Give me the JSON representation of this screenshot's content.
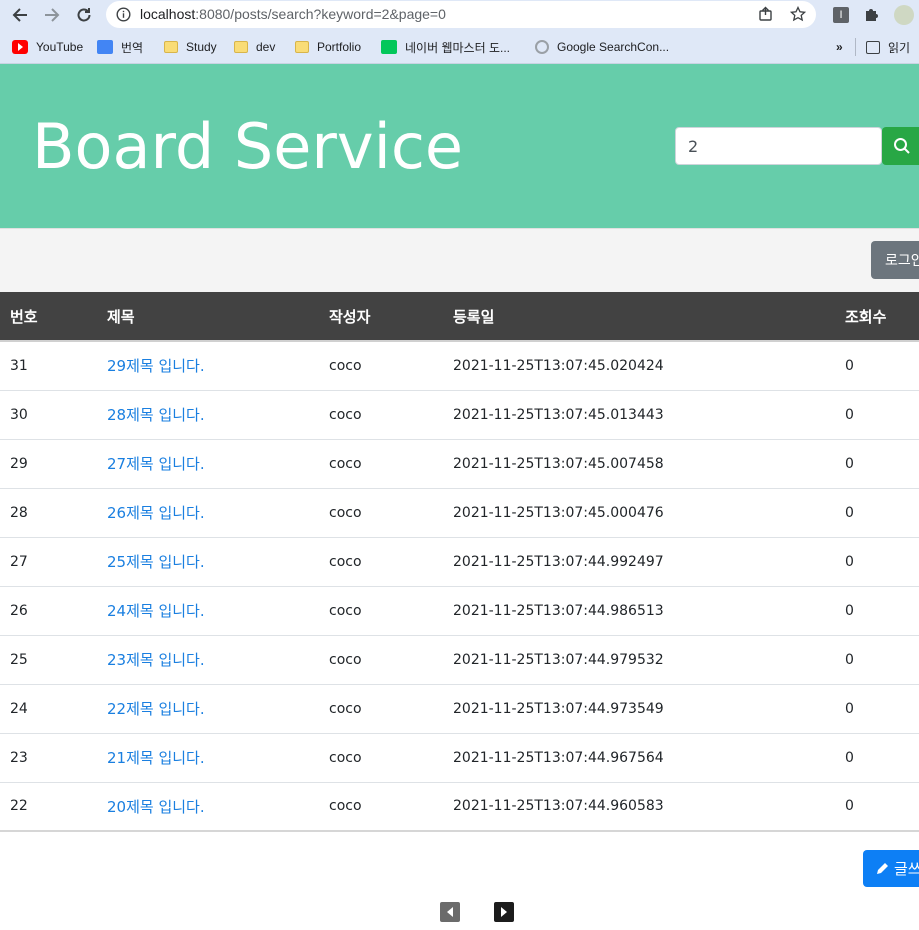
{
  "browser": {
    "url_host": "localhost",
    "url_rest": ":8080/posts/search?keyword=2&page=0",
    "bookmarks": [
      {
        "label": "YouTube",
        "icon": "youtube-icon"
      },
      {
        "label": "번역",
        "icon": "translate-icon"
      },
      {
        "label": "Study",
        "icon": "folder-icon"
      },
      {
        "label": "dev",
        "icon": "folder-icon"
      },
      {
        "label": "Portfolio",
        "icon": "folder-icon"
      },
      {
        "label": "네이버 웹마스터 도...",
        "icon": "naver-icon"
      },
      {
        "label": "Google SearchCon...",
        "icon": "search-console-icon"
      }
    ],
    "reading_list_label": "읽기"
  },
  "header": {
    "title": "Board Service",
    "search_value": "2",
    "bg_color": "#66cdaa"
  },
  "subbar": {
    "login_label": "로그인"
  },
  "table": {
    "columns": [
      "번호",
      "제목",
      "작성자",
      "등록일",
      "조회수"
    ],
    "rows": [
      {
        "no": "31",
        "title": "29제목 입니다.",
        "author": "coco",
        "date": "2021-11-25T13:07:45.020424",
        "views": "0"
      },
      {
        "no": "30",
        "title": "28제목 입니다.",
        "author": "coco",
        "date": "2021-11-25T13:07:45.013443",
        "views": "0"
      },
      {
        "no": "29",
        "title": "27제목 입니다.",
        "author": "coco",
        "date": "2021-11-25T13:07:45.007458",
        "views": "0"
      },
      {
        "no": "28",
        "title": "26제목 입니다.",
        "author": "coco",
        "date": "2021-11-25T13:07:45.000476",
        "views": "0"
      },
      {
        "no": "27",
        "title": "25제목 입니다.",
        "author": "coco",
        "date": "2021-11-25T13:07:44.992497",
        "views": "0"
      },
      {
        "no": "26",
        "title": "24제목 입니다.",
        "author": "coco",
        "date": "2021-11-25T13:07:44.986513",
        "views": "0"
      },
      {
        "no": "25",
        "title": "23제목 입니다.",
        "author": "coco",
        "date": "2021-11-25T13:07:44.979532",
        "views": "0"
      },
      {
        "no": "24",
        "title": "22제목 입니다.",
        "author": "coco",
        "date": "2021-11-25T13:07:44.973549",
        "views": "0"
      },
      {
        "no": "23",
        "title": "21제목 입니다.",
        "author": "coco",
        "date": "2021-11-25T13:07:44.967564",
        "views": "0"
      },
      {
        "no": "22",
        "title": "20제목 입니다.",
        "author": "coco",
        "date": "2021-11-25T13:07:44.960583",
        "views": "0"
      }
    ]
  },
  "actions": {
    "write_label": "글쓰기"
  },
  "pager": {
    "prev_icon": "caret-left-icon",
    "next_icon": "caret-right-icon"
  }
}
